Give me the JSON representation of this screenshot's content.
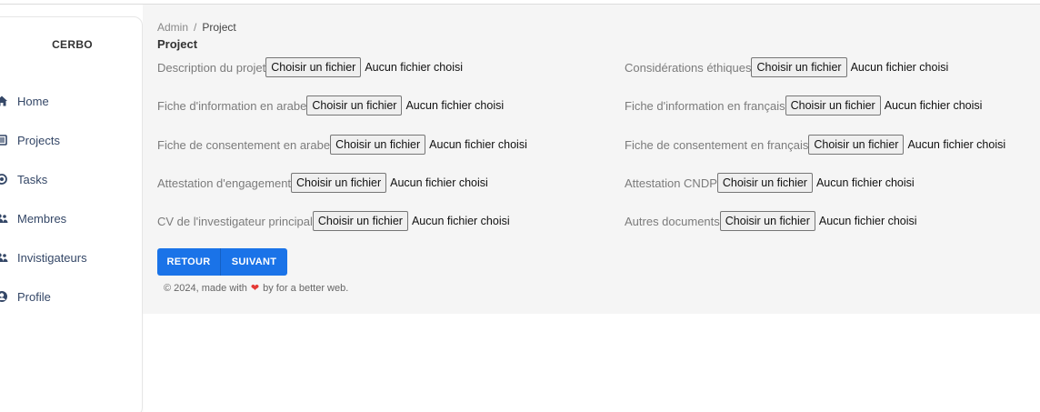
{
  "sidebar": {
    "brand": "CERBO",
    "items": [
      {
        "label": "Home",
        "icon": "home-icon"
      },
      {
        "label": "Projects",
        "icon": "list-icon"
      },
      {
        "label": "Tasks",
        "icon": "tasks-icon"
      },
      {
        "label": "Membres",
        "icon": "members-icon"
      },
      {
        "label": "Invistigateurs",
        "icon": "investigators-icon"
      },
      {
        "label": "Profile",
        "icon": "profile-icon"
      }
    ]
  },
  "breadcrumb": {
    "root": "Admin",
    "separator": "/",
    "current": "Project"
  },
  "page_title": "Project",
  "file_button_label": "Choisir un fichier",
  "file_status": "Aucun fichier choisi",
  "fields_left": [
    {
      "label": "Description du projet"
    },
    {
      "label": "Fiche d'information en arabe"
    },
    {
      "label": "Fiche de consentement en arabe"
    },
    {
      "label": "Attestation d'engagement"
    },
    {
      "label": "CV de l'investigateur principal"
    }
  ],
  "fields_right": [
    {
      "label": "Considérations éthiques"
    },
    {
      "label": "Fiche d'information en français"
    },
    {
      "label": "Fiche de consentement en français"
    },
    {
      "label": "Attestation CNDP"
    },
    {
      "label": "Autres documents"
    }
  ],
  "buttons": {
    "back": "RETOUR",
    "next": "SUIVANT"
  },
  "footer": {
    "prefix": "© 2024, made with",
    "suffix": "by for a better web."
  },
  "colors": {
    "accent": "#1a73e8",
    "heart": "#e53935"
  }
}
